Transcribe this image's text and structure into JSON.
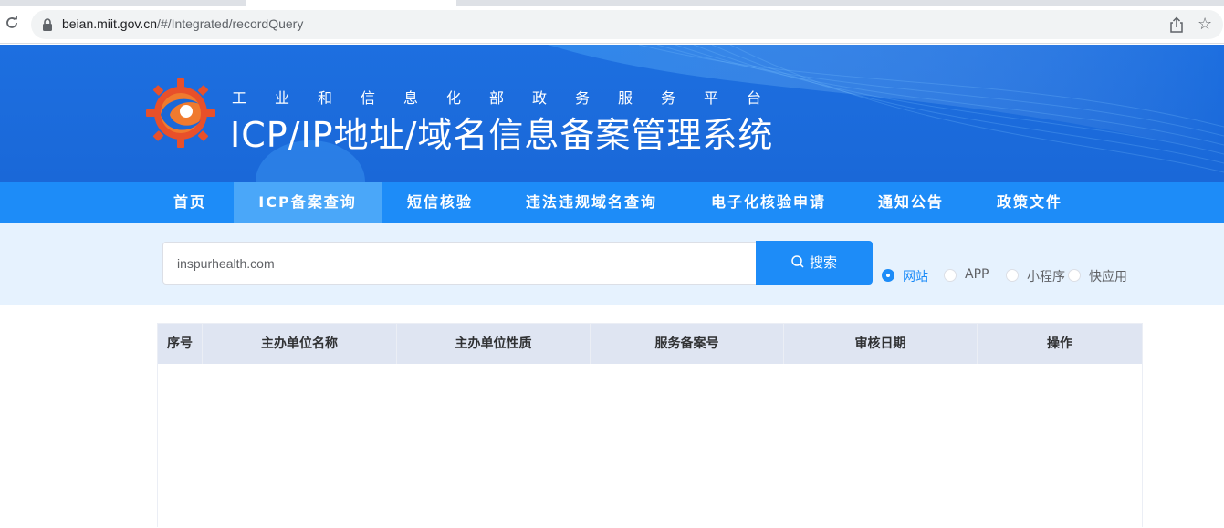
{
  "browser": {
    "url_host": "beian.miit.gov.cn",
    "url_path": "/#/Integrated/recordQuery"
  },
  "header": {
    "subtitle": "工业和信息化部政务服务平台",
    "title": "ICP/IP地址/域名信息备案管理系统"
  },
  "nav": {
    "items": [
      {
        "label": "首页"
      },
      {
        "label": "ICP备案查询"
      },
      {
        "label": "短信核验"
      },
      {
        "label": "违法违规域名查询"
      },
      {
        "label": "电子化核验申请"
      },
      {
        "label": "通知公告"
      },
      {
        "label": "政策文件"
      }
    ],
    "active_index": 1
  },
  "search": {
    "value": "inspurhealth.com",
    "button_label": "搜索",
    "types": [
      {
        "label": "网站",
        "checked": true
      },
      {
        "label": "APP",
        "checked": false
      },
      {
        "label": "小程序",
        "checked": false
      },
      {
        "label": "快应用",
        "checked": false
      }
    ]
  },
  "table": {
    "columns": [
      "序号",
      "主办单位名称",
      "主办单位性质",
      "服务备案号",
      "审核日期",
      "操作"
    ],
    "rows": []
  },
  "colors": {
    "brand_blue": "#1d8cf8",
    "banner_blue": "#1a68d8",
    "search_band": "#e6f2fe",
    "table_header": "#dfe5f2"
  }
}
